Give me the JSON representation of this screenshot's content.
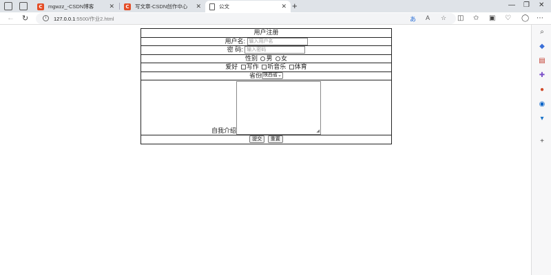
{
  "browser": {
    "tabs": [
      {
        "title": "mgwzz_-CSDN博客",
        "favicon": "C",
        "active": false
      },
      {
        "title": "写文章-CSDN创作中心",
        "favicon": "C",
        "active": false
      },
      {
        "title": "公文",
        "favicon": "document-icon",
        "active": true
      }
    ],
    "new_tab_label": "+",
    "url_host": "127.0.0.1",
    "url_path": ":5500/作业2.html",
    "accent_color": "#e44d26"
  },
  "form": {
    "title": "用户注册",
    "username_label": "用户名:",
    "username_placeholder": "输入用户名",
    "password_label": "密 码:",
    "password_placeholder": "输入密码",
    "gender_label": "性别",
    "gender_options": [
      "男",
      "女"
    ],
    "hobby_label": "爱好",
    "hobby_options": [
      "写作",
      "听音乐",
      "体育"
    ],
    "province_label": "省份",
    "province_selected": "陕西省",
    "intro_label": "自我介绍",
    "submit_label": "提交",
    "reset_label": "重置"
  }
}
